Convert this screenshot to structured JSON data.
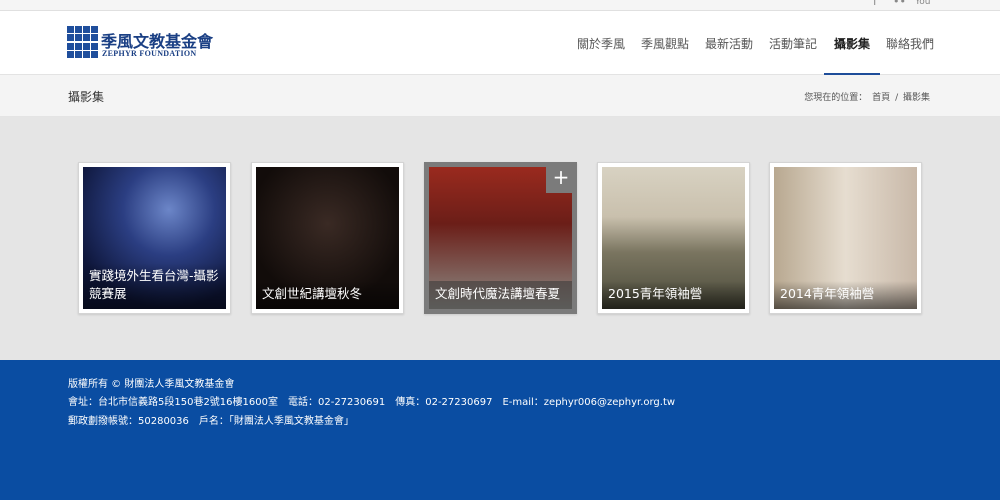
{
  "social": {
    "facebook_icon": "f",
    "flickr_icon": "••",
    "youtube_icon": "You"
  },
  "logo": {
    "title": "季風文教基金會",
    "subtitle": "ZEPHYR FOUNDATION"
  },
  "nav": {
    "items": [
      {
        "label": "關於季風",
        "active": false
      },
      {
        "label": "季風觀點",
        "active": false
      },
      {
        "label": "最新活動",
        "active": false
      },
      {
        "label": "活動筆記",
        "active": false
      },
      {
        "label": "攝影集",
        "active": true
      },
      {
        "label": "聯絡我們",
        "active": false
      }
    ]
  },
  "titlebar": {
    "title": "攝影集",
    "breadcrumb_prefix": "您現在的位置：",
    "breadcrumb_home": "首頁",
    "breadcrumb_sep": "/",
    "breadcrumb_current": "攝影集"
  },
  "gallery": {
    "items": [
      {
        "caption": "實踐境外生看台灣-攝影競賽展"
      },
      {
        "caption": "文創世紀講壇秋冬"
      },
      {
        "caption": "文創時代魔法講壇春夏"
      },
      {
        "caption": "2015青年領袖營"
      },
      {
        "caption": "2014青年領袖營"
      }
    ],
    "hover_icon": "+"
  },
  "footer": {
    "line1": "版權所有 © 財團法人季風文教基金會",
    "line2": "會址：台北市信義路5段150巷2號16樓1600室　電話：02-27230691　傳真：02-27230697　E-mail：zephyr006@zephyr.org.tw",
    "line3": "郵政劃撥帳號：50280036　戶名：「財團法人季風文教基金會」"
  }
}
